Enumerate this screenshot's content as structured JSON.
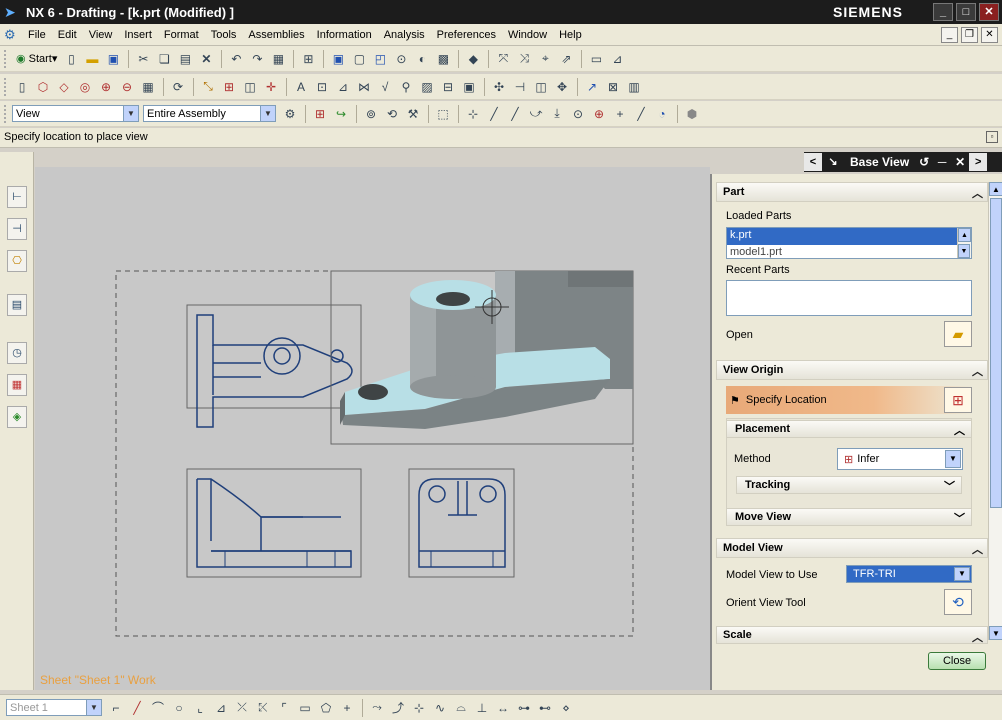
{
  "window": {
    "title": "NX 6 - Drafting - [k.prt (Modified) ]",
    "brand": "SIEMENS",
    "controls": [
      "_",
      "□",
      "✕"
    ]
  },
  "menubar": {
    "items": [
      "File",
      "Edit",
      "View",
      "Insert",
      "Format",
      "Tools",
      "Assemblies",
      "Information",
      "Analysis",
      "Preferences",
      "Window",
      "Help"
    ]
  },
  "toolbar1": {
    "start_label": "Start"
  },
  "toolbar3": {
    "view_combo": "View",
    "assembly_combo": "Entire Assembly"
  },
  "cue": {
    "text": "Specify location to place view"
  },
  "canvas": {
    "sheet_status": "Sheet \"Sheet 1\" Work"
  },
  "bottombar": {
    "sheet_combo": "Sheet 1"
  },
  "dialog": {
    "title": "Base View",
    "part": {
      "header": "Part",
      "loaded_label": "Loaded Parts",
      "loaded_items": [
        "k.prt",
        "model1.prt"
      ],
      "recent_label": "Recent Parts",
      "open_label": "Open"
    },
    "view_origin": {
      "header": "View Origin",
      "specify_label": "Specify Location",
      "placement_header": "Placement",
      "method_label": "Method",
      "method_value": "Infer",
      "tracking_header": "Tracking",
      "move_view_header": "Move View"
    },
    "model_view": {
      "header": "Model View",
      "use_label": "Model View to Use",
      "use_value": "TFR-TRI",
      "orient_label": "Orient View Tool"
    },
    "scale": {
      "header": "Scale"
    },
    "close_label": "Close"
  },
  "colors": {
    "canvas": "#c8c8c8",
    "drawing_line": "#1f3f7a",
    "model_face": "#8a8f90",
    "model_highlight": "#b8dfe6",
    "selection": "#316ac5",
    "status_text": "#e9a040"
  }
}
